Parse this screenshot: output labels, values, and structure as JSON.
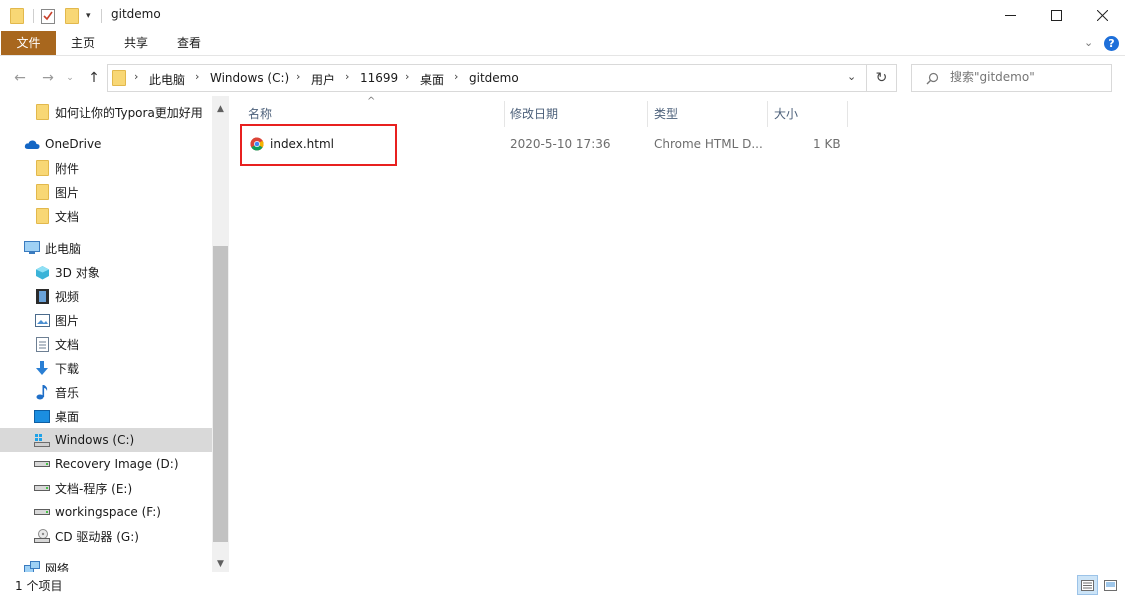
{
  "window": {
    "title": "gitdemo",
    "minimize_icon": "minimize-icon",
    "maximize_icon": "maximize-icon",
    "close_icon": "close-icon"
  },
  "ribbon": {
    "tabs": [
      {
        "label": "文件",
        "active": true
      },
      {
        "label": "主页"
      },
      {
        "label": "共享"
      },
      {
        "label": "查看"
      }
    ],
    "help_icon": "help-icon",
    "expand_icon": "chevron-down-icon"
  },
  "address": {
    "crumbs": [
      "此电脑",
      "Windows (C:)",
      "用户",
      "11699",
      "桌面",
      "gitdemo"
    ]
  },
  "search": {
    "placeholder": "搜索\"gitdemo\""
  },
  "navpane": {
    "items": [
      {
        "label": "如何让你的Typora更加好用",
        "icon": "folder-icon",
        "indent": 1
      },
      {
        "label": "OneDrive",
        "icon": "cloud-icon",
        "indent": 0
      },
      {
        "label": "附件",
        "icon": "folder-icon",
        "indent": 1
      },
      {
        "label": "图片",
        "icon": "folder-icon",
        "indent": 1
      },
      {
        "label": "文档",
        "icon": "folder-icon",
        "indent": 1
      },
      {
        "label": "此电脑",
        "icon": "computer-icon",
        "indent": 0
      },
      {
        "label": "3D 对象",
        "icon": "cube-icon",
        "indent": 1
      },
      {
        "label": "视频",
        "icon": "video-icon",
        "indent": 1
      },
      {
        "label": "图片",
        "icon": "pictures-icon",
        "indent": 1
      },
      {
        "label": "文档",
        "icon": "document-icon",
        "indent": 1
      },
      {
        "label": "下载",
        "icon": "download-icon",
        "indent": 1
      },
      {
        "label": "音乐",
        "icon": "music-icon",
        "indent": 1
      },
      {
        "label": "桌面",
        "icon": "desktop-icon",
        "indent": 1
      },
      {
        "label": "Windows (C:)",
        "icon": "windows-drive-icon",
        "indent": 1,
        "selected": true
      },
      {
        "label": "Recovery Image (D:)",
        "icon": "drive-icon",
        "indent": 1
      },
      {
        "label": "文档-程序 (E:)",
        "icon": "drive-icon",
        "indent": 1
      },
      {
        "label": "workingspace (F:)",
        "icon": "drive-icon",
        "indent": 1
      },
      {
        "label": "CD 驱动器 (G:)",
        "icon": "cd-drive-icon",
        "indent": 1
      },
      {
        "label": "网络",
        "icon": "network-icon",
        "indent": 0
      }
    ]
  },
  "filelist": {
    "columns": [
      "名称",
      "修改日期",
      "类型",
      "大小"
    ],
    "rows": [
      {
        "name": "index.html",
        "modified": "2020-5-10 17:36",
        "type": "Chrome HTML D...",
        "size": "1 KB",
        "icon": "chrome-icon"
      }
    ]
  },
  "status": {
    "text": "1 个项目"
  },
  "colors": {
    "file_tab": "#a8671e",
    "highlight": "#e8201f",
    "folder": "#f8d775",
    "header_text": "#4c607a"
  }
}
